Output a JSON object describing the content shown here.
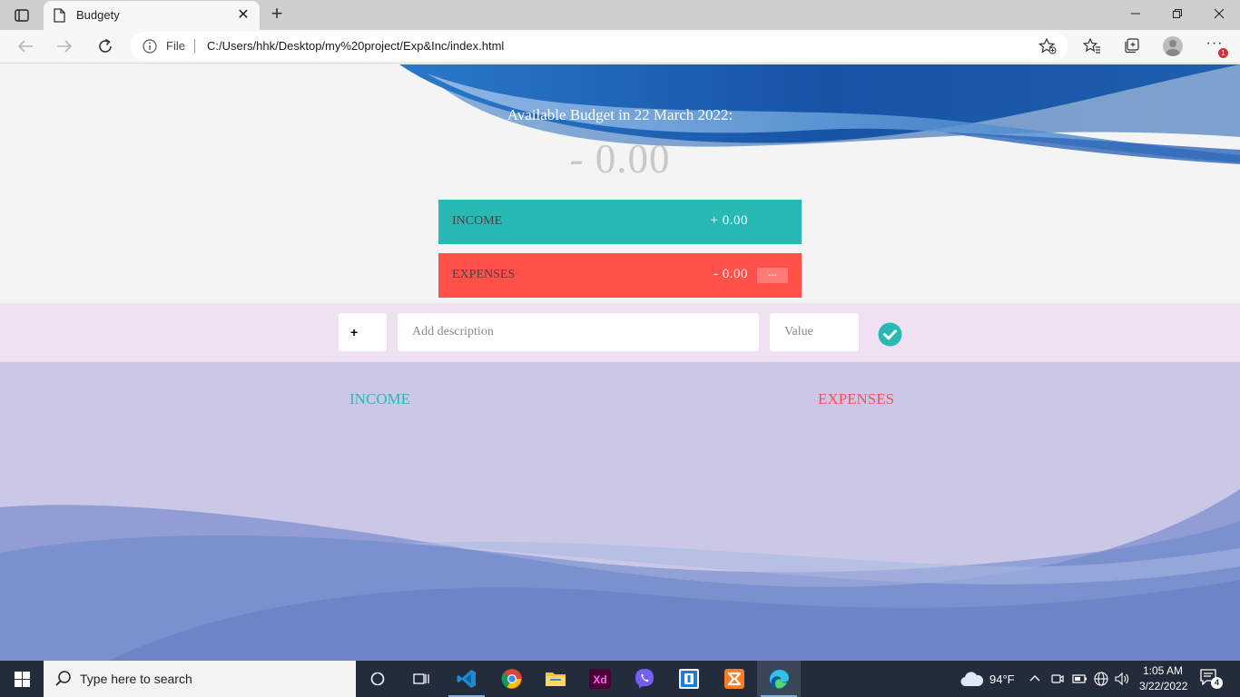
{
  "browser": {
    "tab_title": "Budgety",
    "url_scheme_label": "File",
    "url": "C:/Users/hhk/Desktop/my%20project/Exp&Inc/index.html",
    "notification_count": "1"
  },
  "budget": {
    "title": "Available Budget in 22 March 2022:",
    "value": "- 0.00"
  },
  "summary": {
    "income_label": "INCOME",
    "income_value": "+ 0.00",
    "expenses_label": "EXPENSES",
    "expenses_value": "- 0.00",
    "expenses_percentage": "---"
  },
  "add_form": {
    "type_selected": "+",
    "description_placeholder": "Add description",
    "value_placeholder": "Value"
  },
  "lists": {
    "income_title": "INCOME",
    "expenses_title": "EXPENSES"
  },
  "taskbar": {
    "search_placeholder": "Type here to search",
    "apps": [
      "task-view",
      "vscode",
      "chrome",
      "file-explorer",
      "adobe-xd",
      "viber",
      "sourcetree",
      "xampp",
      "edge"
    ],
    "temperature": "94°F",
    "time": "1:05 AM",
    "date": "3/22/2022",
    "notification_count": "4"
  },
  "colors": {
    "income": "#28b9b5",
    "expenses": "#ff5049",
    "add_bar": "#efe1f1",
    "bottom_bg": "#cbc7e6",
    "wave_blue": "#1b5fb0"
  }
}
